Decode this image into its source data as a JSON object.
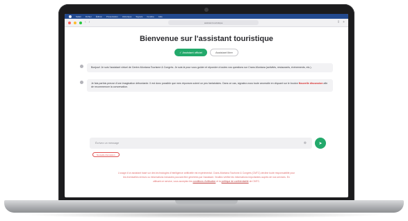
{
  "menubar": {
    "items": [
      "Safari",
      "Fichier",
      "Édition",
      "Présentation",
      "Historique",
      "Signets",
      "Fenêtre",
      "Aide"
    ]
  },
  "browser": {
    "url": "assistant.touristique"
  },
  "page": {
    "title": "Bienvenue sur l'assistant touristique",
    "modes": {
      "active": "✓ Assistant officiel",
      "inactive": "Assistant libre"
    },
    "messages": [
      {
        "text": "Bonjour! Je suis l'assistant virtuel de Centre-Montana Tourisme & Congrès. Je suis là pour vous guider et répondre à toutes vos questions sur Crans-Montana (activités, restaurants, événements, etc.)."
      },
      {
        "text_before": "Je fais parfois preuve d'une imagination débordante. Il est donc possible que mes réponses soient un peu fantaisistes. Dans ce cas, signalez-nous toute anomalie en cliquant sur le bouton ",
        "warn": "Nouvelle discussion",
        "text_after": " afin de recommencer la conversation."
      }
    ],
    "composer": {
      "placeholder": "Écrivez un message",
      "send_icon": "send-arrow-icon",
      "field_icon": "clear-icon"
    },
    "new_chat_label": "Nouvelle discussion",
    "disclaimer": {
      "line1": "L'usage d'un assistant basé sur des technologies d'intelligence artificielle est expérimental. Crans-Montana Tourisme & Congrès (CMTC) décline toute responsabilité pour",
      "line2": "les éventuelles erreurs ou informations inexactes pouvant être générées par l'assistant. Veuillez vérifier les informations importantes auprès de nos services. En",
      "line3_before": "utilisant ce service, vous acceptez les ",
      "link1": "conditions d'utilisation",
      "line3_mid": " et la ",
      "link2": "politique de confidentialité",
      "line3_after": " de CMTC."
    }
  },
  "colors": {
    "accent_green": "#23a96b",
    "warning_red": "#d62c2c",
    "menubar_blue": "#234a8f"
  }
}
